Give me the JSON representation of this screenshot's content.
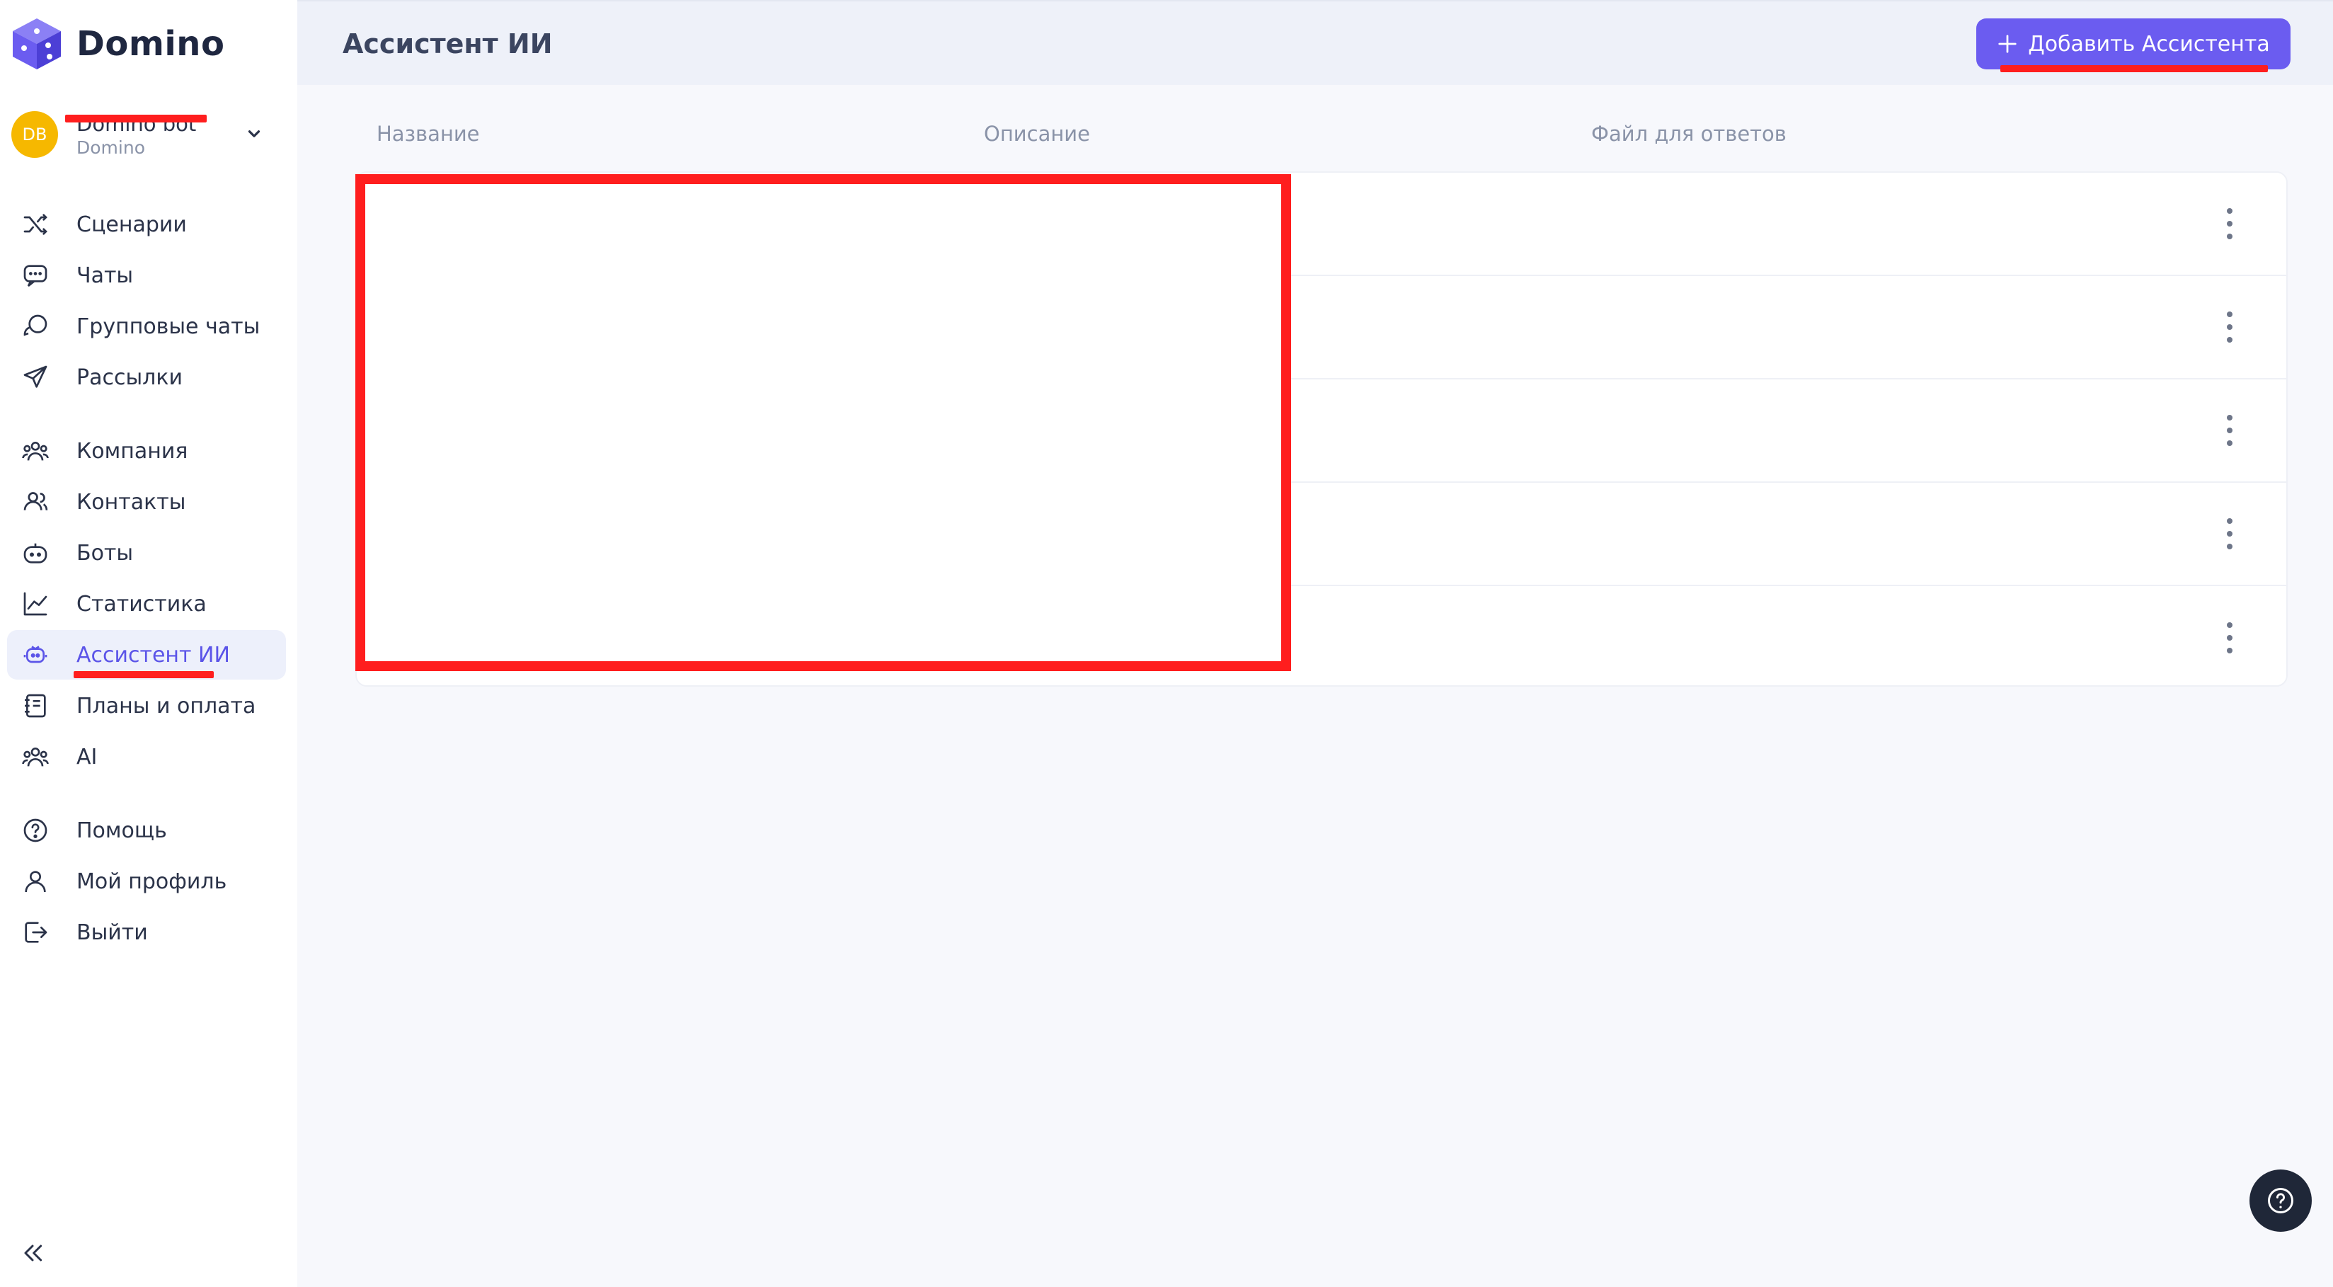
{
  "brand": {
    "name": "Domino",
    "accent": "#6b5cf0"
  },
  "account": {
    "initials": "DB",
    "name": "Domino bot",
    "subtitle": "Domino"
  },
  "sidebar": {
    "items": [
      {
        "label": "Сценарии",
        "icon": "shuffle-icon"
      },
      {
        "label": "Чаты",
        "icon": "chat-icon"
      },
      {
        "label": "Групповые чаты",
        "icon": "group-chat-icon"
      },
      {
        "label": "Рассылки",
        "icon": "send-icon"
      },
      {
        "label": "Компания",
        "icon": "company-icon"
      },
      {
        "label": "Контакты",
        "icon": "contacts-icon"
      },
      {
        "label": "Боты",
        "icon": "bot-icon"
      },
      {
        "label": "Статистика",
        "icon": "chart-icon"
      },
      {
        "label": "Ассистент ИИ",
        "icon": "assistant-icon",
        "active": true
      },
      {
        "label": "Планы и оплата",
        "icon": "billing-icon"
      },
      {
        "label": "AI",
        "icon": "ai-icon"
      },
      {
        "label": "Помощь",
        "icon": "help-icon"
      },
      {
        "label": "Мой профиль",
        "icon": "user-icon"
      },
      {
        "label": "Выйти",
        "icon": "logout-icon"
      }
    ]
  },
  "header": {
    "title": "Ассистент ИИ",
    "add_button": "Добавить Ассистента"
  },
  "table": {
    "columns": [
      "Название",
      "Описание",
      "Файл для ответов"
    ],
    "row_count": 5
  }
}
